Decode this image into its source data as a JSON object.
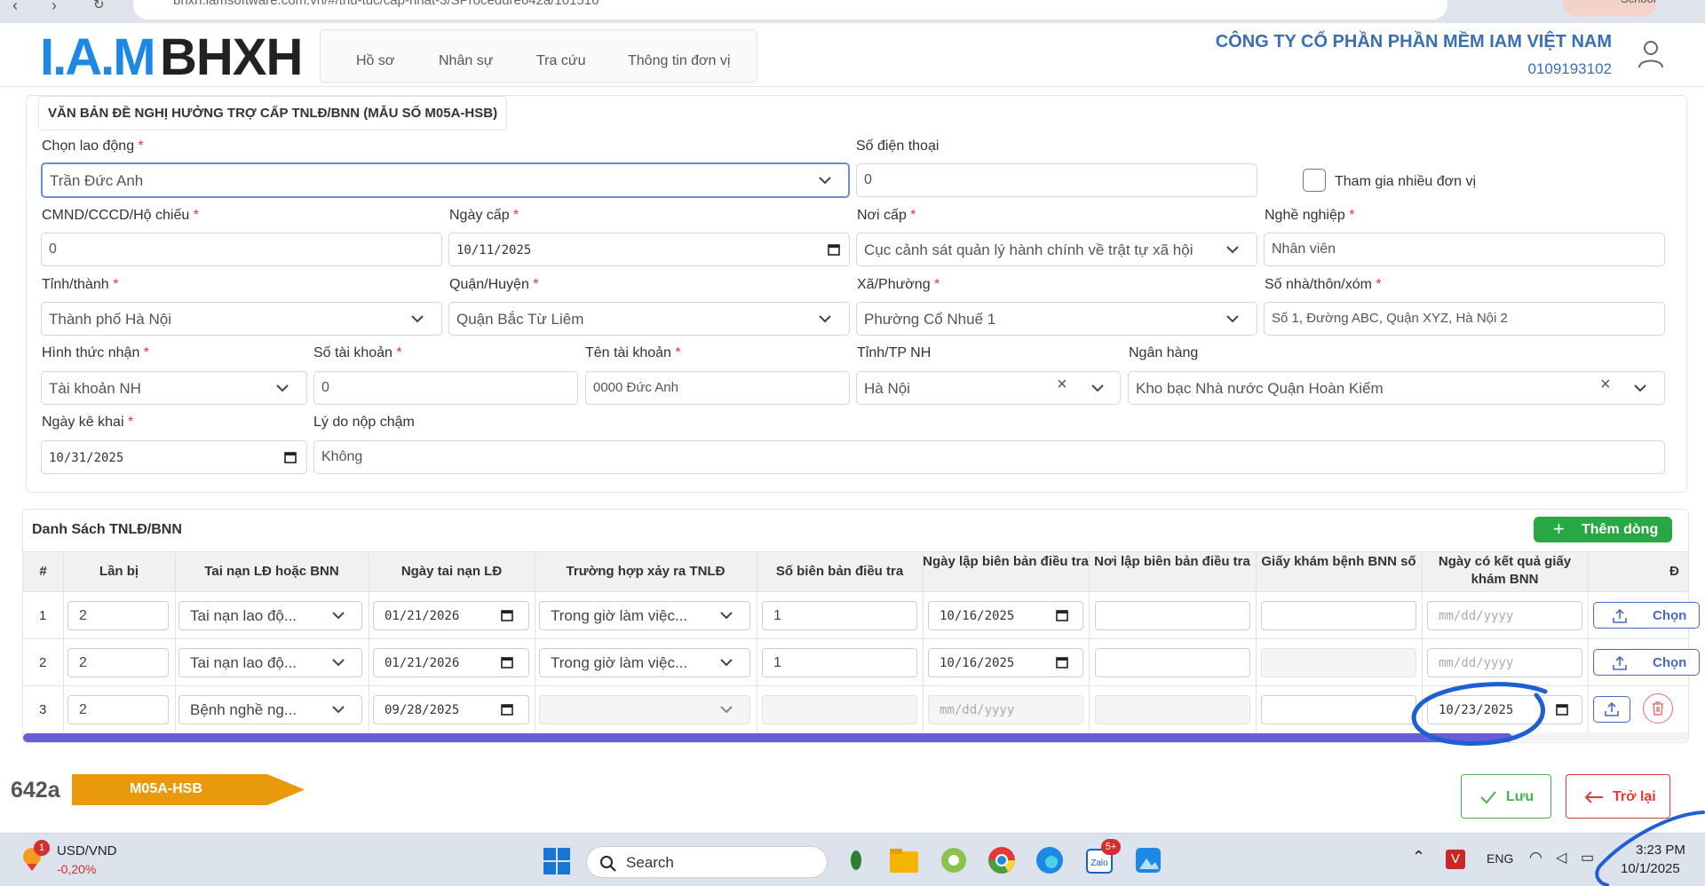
{
  "browser": {
    "url": "bhxh.iamsoftware.com.vn/#/thu-tuc/cap-nhat-3/SProcedure642a/101516",
    "profile_label": "School"
  },
  "header": {
    "logo_iam": "I.A.M",
    "logo_bhxh": "BHXH",
    "nav": [
      "Hồ sơ",
      "Nhân sự",
      "Tra cứu",
      "Thông tin đơn vị"
    ],
    "company_name": "CÔNG TY CỔ PHẦN PHẦN MỀM IAM VIỆT NAM",
    "company_code": "0109193102"
  },
  "form": {
    "title": "VĂN BẢN ĐỀ NGHỊ HƯỞNG TRỢ CẤP TNLĐ/BNN (MẪU SỐ M05A-HSB)",
    "employee": {
      "label": "Chọn lao động",
      "value": "Trần Đức Anh"
    },
    "phone": {
      "label": "Số điện thoại",
      "value": "0"
    },
    "multi_unit": {
      "label": "Tham gia nhiều đơn vị",
      "checked": false
    },
    "id_number": {
      "label": "CMND/CCCD/Hộ chiếu",
      "value": "0"
    },
    "issue_date": {
      "label": "Ngày cấp",
      "value": "10/11/2025"
    },
    "issue_place": {
      "label": "Nơi cấp",
      "value": "Cục cảnh sát quản lý hành chính về trật tự xã hội"
    },
    "occupation": {
      "label": "Nghề nghiệp",
      "value": "Nhân viên"
    },
    "province": {
      "label": "Tỉnh/thành",
      "value": "Thành phố Hà Nội"
    },
    "district": {
      "label": "Quận/Huyện",
      "value": "Quận Bắc Từ Liêm"
    },
    "ward": {
      "label": "Xã/Phường",
      "value": "Phường Cổ Nhuế 1"
    },
    "address": {
      "label": "Số nhà/thôn/xóm",
      "value": "Số 1, Đường ABC, Quận XYZ, Hà Nội 2"
    },
    "receive_method": {
      "label": "Hình thức nhận",
      "value": "Tài khoản NH"
    },
    "account_number": {
      "label": "Số tài khoản",
      "value": "0"
    },
    "account_name": {
      "label": "Tên tài khoản",
      "value": "0000 Đức Anh"
    },
    "bank_province": {
      "label": "Tỉnh/TP NH",
      "value": "Hà Nội"
    },
    "bank": {
      "label": "Ngân hàng",
      "value": "Kho bạc Nhà nước Quận Hoàn Kiếm"
    },
    "declare_date": {
      "label": "Ngày kê khai",
      "value": "10/31/2025"
    },
    "late_reason": {
      "label": "Lý do nộp chậm",
      "value": "Không"
    }
  },
  "table": {
    "title": "Danh Sách TNLĐ/BNN",
    "add_button": "Thêm dòng",
    "headers": [
      "#",
      "Lần bị",
      "Tai nạn LĐ hoặc BNN",
      "Ngày tai nạn LĐ",
      "Trường hợp xảy ra TNLĐ",
      "Số biên bản điều tra",
      "Ngày lập biên bản điều tra",
      "Nơi lập biên bản điều tra",
      "Giấy khám bệnh BNN số",
      "Ngày có kết quả giấy khám BNN",
      "Đ"
    ],
    "date_placeholder": "mm/dd/yyyy",
    "upload_label": "Chọn",
    "rows": [
      {
        "index": "1",
        "times": "2",
        "type": "Tai nạn lao độ...",
        "accident_date": "01/21/2026",
        "case": "Trong giờ làm việc...",
        "report_no": "1",
        "report_date": "10/16/2025",
        "report_place": "",
        "bnn_no": "",
        "bnn_date": ""
      },
      {
        "index": "2",
        "times": "2",
        "type": "Tai nạn lao độ...",
        "accident_date": "01/21/2026",
        "case": "Trong giờ làm việc...",
        "report_no": "1",
        "report_date": "10/16/2025",
        "report_place": "",
        "bnn_no": "",
        "bnn_date": ""
      },
      {
        "index": "3",
        "times": "2",
        "type": "Bệnh nghề ng...",
        "accident_date": "09/28/2025",
        "case": "",
        "report_no": "",
        "report_date": "",
        "report_place": "",
        "bnn_no": "",
        "bnn_date": "10/23/2025"
      }
    ]
  },
  "footer": {
    "procedure_code": "642a",
    "form_code": "M05A-HSB",
    "save_label": "Lưu",
    "back_label": "Trở lại"
  },
  "taskbar": {
    "ticker_name": "USD/VND",
    "ticker_change": "-0,20%",
    "ticker_badge": "1",
    "search_label": "Search",
    "zalo_badge": "5+",
    "lang": "ENG",
    "time": "3:23 PM",
    "date": "10/1/2025"
  },
  "colors": {
    "accent_blue": "#3a6fb0",
    "logo_blue": "#1e88e5",
    "success_green": "#28a745",
    "danger_red": "#e53935",
    "scrollbar": "#6a5ddc",
    "form_code_orange": "#e89a0c",
    "annotation_ink": "#1f5fd6"
  }
}
